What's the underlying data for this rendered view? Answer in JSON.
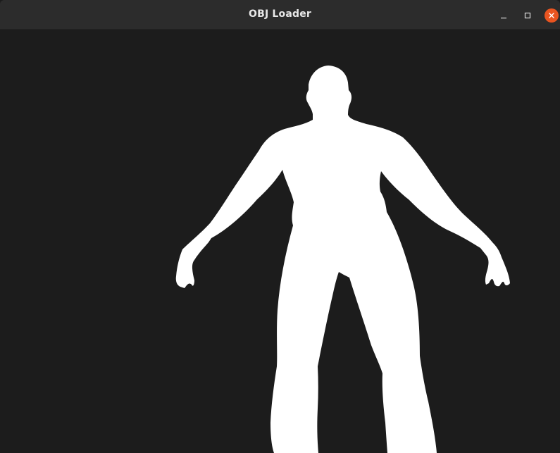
{
  "window": {
    "title": "OBJ Loader",
    "controls": {
      "minimize_icon": "minimize-icon",
      "maximize_icon": "maximize-icon",
      "close_icon": "close-icon",
      "close_color": "#e95420"
    }
  },
  "viewport": {
    "background": "#1c1c1c",
    "model_color": "#ffffff",
    "model": "humanoid-figure"
  }
}
